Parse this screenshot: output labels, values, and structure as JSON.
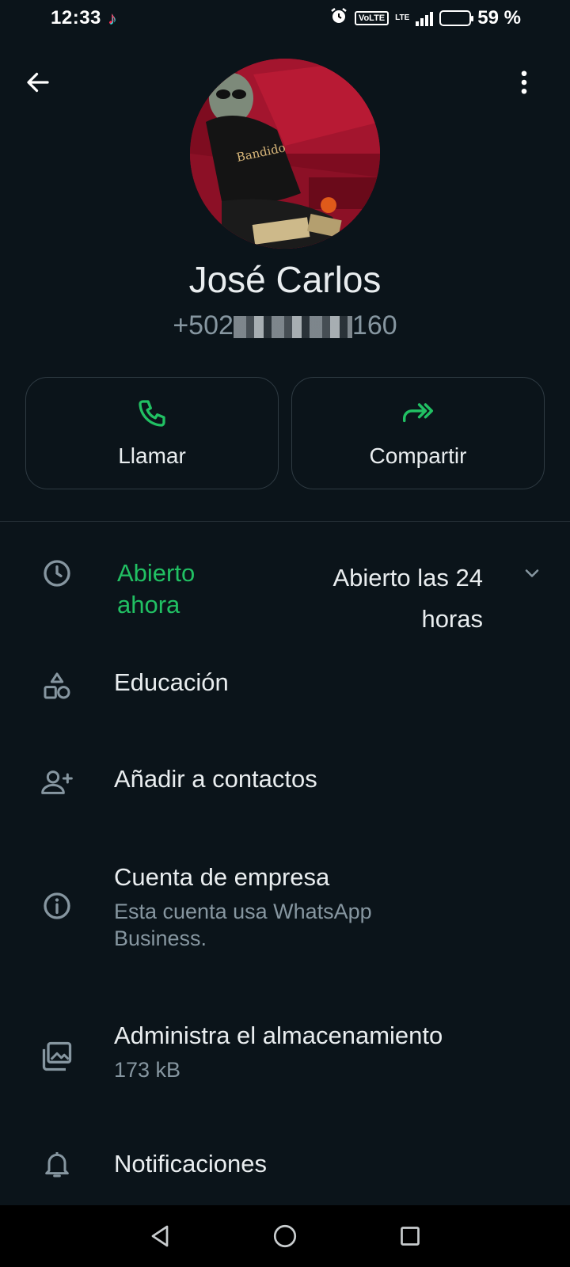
{
  "status_bar": {
    "time": "12:33",
    "volte": "VoLTE",
    "lte": "LTE",
    "battery_percent": "59 %",
    "battery_level": 0.59
  },
  "header": {
    "back_icon": "arrow-left-icon",
    "menu_icon": "more-vertical-icon"
  },
  "profile": {
    "avatar_text": "Bandido",
    "name": "José Carlos",
    "phone_prefix": "+502",
    "phone_suffix": "160"
  },
  "actions": [
    {
      "label": "Llamar",
      "icon": "phone-icon"
    },
    {
      "label": "Compartir",
      "icon": "share-forward-icon"
    }
  ],
  "hours": {
    "status": "Abierto ahora",
    "value": "Abierto las 24 horas"
  },
  "items": {
    "category": {
      "title": "Educación",
      "icon": "category-shapes-icon"
    },
    "add_contact": {
      "title": "Añadir a contactos",
      "icon": "person-add-icon"
    },
    "business": {
      "title": "Cuenta de empresa",
      "subtitle": "Esta cuenta usa WhatsApp Business.",
      "icon": "info-icon"
    },
    "storage": {
      "title": "Administra el almacenamiento",
      "subtitle": "173 kB",
      "icon": "gallery-stack-icon"
    },
    "notifications": {
      "title": "Notificaciones",
      "icon": "bell-icon"
    }
  },
  "colors": {
    "background": "#0b141a",
    "accent_green": "#21c063",
    "text_primary": "#e9edef",
    "text_secondary": "#8696a0"
  }
}
